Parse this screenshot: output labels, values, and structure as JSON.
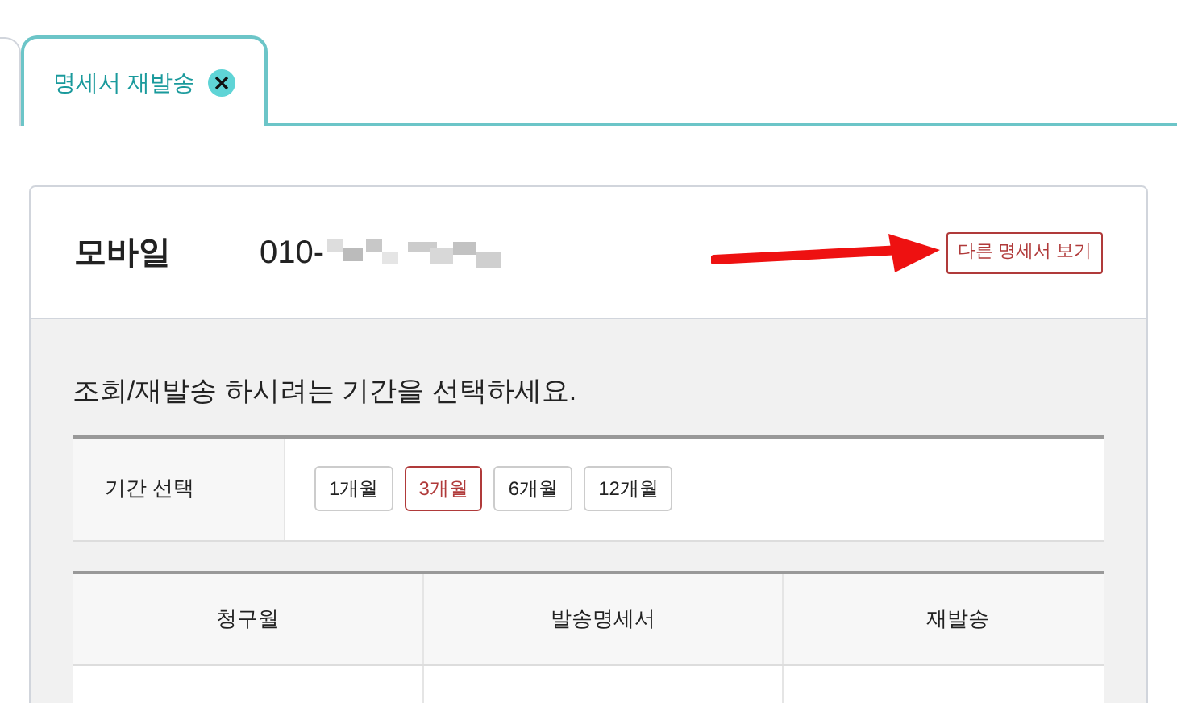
{
  "tabs": [
    {
      "label": "명세서 재발송",
      "selected": true
    }
  ],
  "header": {
    "title": "모바일",
    "phone": "010-",
    "other_button": "다른 명세서 보기"
  },
  "instruction": "조회/재발송 하시려는 기간을 선택하세요.",
  "period": {
    "label": "기간 선택",
    "options": [
      {
        "label": "1개월",
        "selected": false
      },
      {
        "label": "3개월",
        "selected": true
      },
      {
        "label": "6개월",
        "selected": false
      },
      {
        "label": "12개월",
        "selected": false
      }
    ]
  },
  "table": {
    "columns": [
      "청구월",
      "발송명세서",
      "재발송"
    ]
  }
}
